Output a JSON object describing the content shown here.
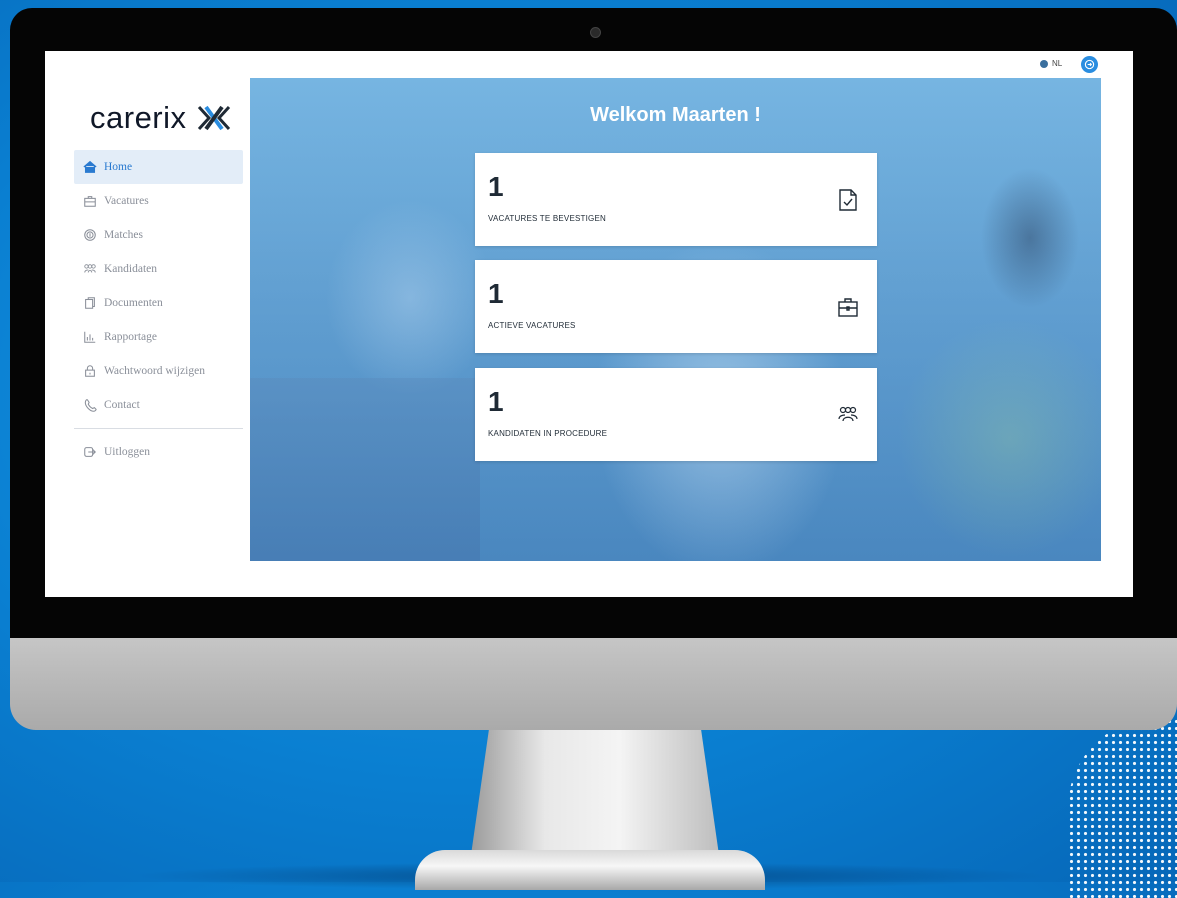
{
  "app": {
    "logo_text": "carerix",
    "language": "NL"
  },
  "sidebar": {
    "items": [
      {
        "label": "Home",
        "icon": "home-icon",
        "active": true
      },
      {
        "label": "Vacatures",
        "icon": "briefcase-icon",
        "active": false
      },
      {
        "label": "Matches",
        "icon": "fingerprint-icon",
        "active": false
      },
      {
        "label": "Kandidaten",
        "icon": "users-icon",
        "active": false
      },
      {
        "label": "Documenten",
        "icon": "documents-icon",
        "active": false
      },
      {
        "label": "Rapportage",
        "icon": "bar-chart-icon",
        "active": false
      },
      {
        "label": "Wachtwoord wijzigen",
        "icon": "lock-icon",
        "active": false
      },
      {
        "label": "Contact",
        "icon": "phone-icon",
        "active": false
      }
    ],
    "logout": {
      "label": "Uitloggen",
      "icon": "logout-icon"
    }
  },
  "main": {
    "welcome": "Welkom Maarten !",
    "cards": [
      {
        "count": "1",
        "label": "VACATURES TE BEVESTIGEN",
        "icon": "document-check-icon"
      },
      {
        "count": "1",
        "label": "ACTIEVE VACATURES",
        "icon": "briefcase-icon"
      },
      {
        "count": "1",
        "label": "KANDIDATEN IN PROCEDURE",
        "icon": "users-icon"
      }
    ]
  },
  "colors": {
    "accent": "#2a7ad0",
    "background": "#0a7fd1",
    "hero": "#5d9fd2"
  }
}
